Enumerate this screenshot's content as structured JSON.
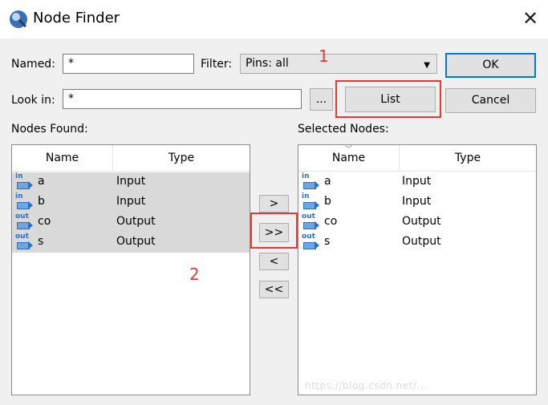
{
  "window": {
    "title": "Node Finder",
    "close_glyph": "✕"
  },
  "named": {
    "label": "Named:",
    "value": "*"
  },
  "filter": {
    "label": "Filter:",
    "value": "Pins: all"
  },
  "look_in": {
    "label": "Look in:",
    "value": "*"
  },
  "buttons": {
    "ok": "OK",
    "ellipsis": "...",
    "list": "List",
    "cancel": "Cancel",
    "add": ">",
    "add_all": ">>",
    "remove": "<",
    "remove_all": "<<"
  },
  "annotations": {
    "one": "1",
    "two": "2"
  },
  "nodes_found": {
    "label": "Nodes Found:",
    "columns": [
      "Name",
      "Type"
    ],
    "rows": [
      {
        "dir": "in",
        "name": "a",
        "type": "Input"
      },
      {
        "dir": "in",
        "name": "b",
        "type": "Input"
      },
      {
        "dir": "out",
        "name": "co",
        "type": "Output"
      },
      {
        "dir": "out",
        "name": "s",
        "type": "Output"
      }
    ]
  },
  "selected_nodes": {
    "label": "Selected Nodes:",
    "columns": [
      "Name",
      "Type"
    ],
    "rows": [
      {
        "dir": "in",
        "name": "a",
        "type": "Input"
      },
      {
        "dir": "in",
        "name": "b",
        "type": "Input"
      },
      {
        "dir": "out",
        "name": "co",
        "type": "Output"
      },
      {
        "dir": "out",
        "name": "s",
        "type": "Output"
      }
    ]
  },
  "colors": {
    "highlight_red": "#e53935",
    "default_button_border": "#0078d7",
    "selection_gray": "#d9d9d9",
    "pin_blue": "#2b6fc7"
  },
  "icons": {
    "app": "node-finder-icon",
    "pin_in": "input-pin-icon",
    "pin_out": "output-pin-icon",
    "close": "close-icon",
    "dropdown": "chevron-down-icon"
  },
  "watermark": "https://blog.csdn.net/..."
}
